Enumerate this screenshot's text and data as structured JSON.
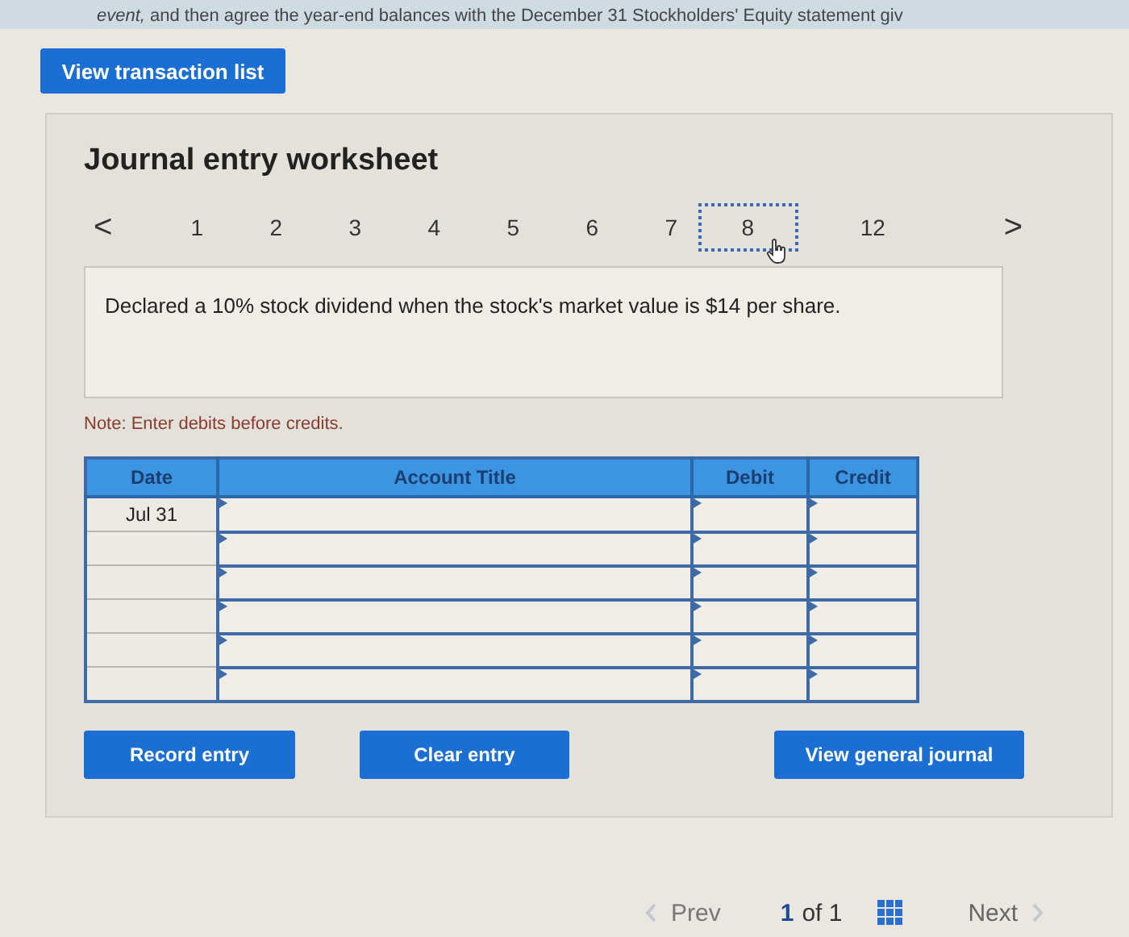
{
  "banner": {
    "text": "*event,* and then agree the year-end balances with the December 31 Stockholders' Equity statement giv"
  },
  "top_button": "View transaction list",
  "worksheet": {
    "title": "Journal entry worksheet",
    "pager": {
      "prev": "<",
      "next": ">",
      "items": [
        {
          "label": "1",
          "selected": false
        },
        {
          "label": "2",
          "selected": false
        },
        {
          "label": "3",
          "selected": false
        },
        {
          "label": "4",
          "selected": false
        },
        {
          "label": "5",
          "selected": false
        },
        {
          "label": "6",
          "selected": false
        },
        {
          "label": "7",
          "selected": false
        },
        {
          "label": "8",
          "selected": true
        },
        {
          "label": "12",
          "selected": false
        }
      ]
    },
    "description": "Declared a 10% stock dividend when the stock's market value is $14 per share.",
    "note": "Note: Enter debits before credits.",
    "table": {
      "columns": [
        "Date",
        "Account Title",
        "Debit",
        "Credit"
      ],
      "rows": [
        {
          "kind": "entry",
          "date": "Jul 31"
        },
        {
          "kind": "entry"
        },
        {
          "kind": "entry"
        },
        {
          "kind": "entry"
        },
        {
          "kind": "entry"
        },
        {
          "kind": "entry"
        }
      ]
    },
    "buttons": [
      "Record entry",
      "Clear entry",
      "View general journal"
    ]
  },
  "footer": {
    "prev": "Prev",
    "page": "1",
    "of": "of 1",
    "next": "Next"
  }
}
